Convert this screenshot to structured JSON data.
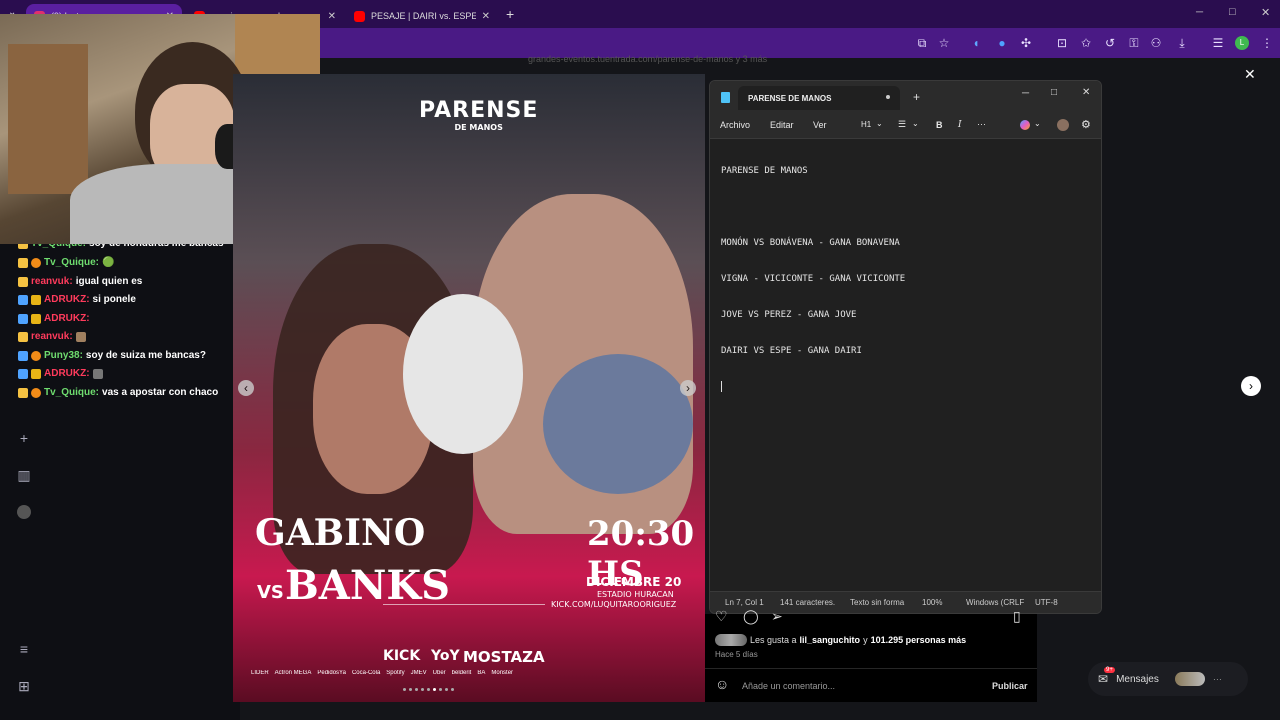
{
  "browser": {
    "tabs": [
      {
        "label": "(9) Instagram",
        "favicon_color": "#e1306c",
        "active": true
      },
      {
        "label": "pesaje parense de manos - You",
        "favicon_color": "#ff0000",
        "active": false
      },
      {
        "label": "PESAJE | DAIRI vs. ESPE | PAREN",
        "favicon_color": "#ff0000",
        "active": false
      }
    ],
    "new_tab": "+",
    "win_min": "─",
    "win_max": "□",
    "win_close": "✕"
  },
  "behind_url": "grandes-eventos.tuentrada.com/parense-de-manos y 3 más",
  "chat": [
    {
      "user": "Tv_Quique:",
      "msg": "soy de honduras me bancas",
      "color": "#6fdc6f"
    },
    {
      "user": "Tv_Quique:",
      "msg": "🟢",
      "color": "#6fdc6f"
    },
    {
      "user": "reanvuk:",
      "msg": "igual quien es",
      "color": "#ff3b5c"
    },
    {
      "user": "ADRUKZ:",
      "msg": "si ponele",
      "color": "#ff3b5c"
    },
    {
      "user": "ADRUKZ:",
      "msg": "",
      "color": "#ff3b5c"
    },
    {
      "user": "reanvuk:",
      "msg": "",
      "color": "#ff3b5c"
    },
    {
      "user": "Puny38:",
      "msg": "soy de suiza me bancas?",
      "color": "#6fdc6f"
    },
    {
      "user": "ADRUKZ:",
      "msg": "",
      "color": "#ff3b5c"
    },
    {
      "user": "Tv_Quique:",
      "msg": "vas a apostar con chaco",
      "color": "#6fdc6f"
    }
  ],
  "poster": {
    "logo_top": "PARENSE",
    "logo_bottom": "DE MANOS",
    "fighter_a": "GABINO",
    "vs": "VS",
    "fighter_b": "BANKS",
    "time": "20:30 HS",
    "date": "DICIEMBRE 20",
    "venue": "ESTADIO HURACAN",
    "site": "KICK.COM/LUQUITAROORIGUEZ",
    "sponsors_main": [
      "KICK",
      "YoY",
      "MOSTAZA"
    ],
    "sponsors_small": [
      "LIDER",
      "Actron MEGA",
      "PedidosYa",
      "Coca-Cola",
      "Spotify",
      "JMEV",
      "Uber",
      "belderit",
      "BA",
      "Monster"
    ]
  },
  "notepad": {
    "title": "PARENSE DE MANOS",
    "new_tab": "+",
    "menu": [
      "Archivo",
      "Editar",
      "Ver"
    ],
    "heading": "H1",
    "bold": "B",
    "italic": "I",
    "more": "···",
    "lines": [
      "PARENSE DE MANOS",
      "",
      "MONÓN VS BONÁVENA - GANA BONAVENA",
      "VIGNA - VICICONTE - GANA VICICONTE",
      "JOVE VS PEREZ - GANA JOVE",
      "DAIRI VS ESPE - GANA DAIRI"
    ],
    "status": {
      "position": "Ln 7, Col 1",
      "chars": "141 caracteres.",
      "format": "Texto sin forma",
      "zoom": "100%",
      "eol": "Windows (CRLF",
      "encoding": "UTF-8"
    }
  },
  "instagram": {
    "likes_prefix": "Les gusta a",
    "likes_user": "lil_sanguchito",
    "likes_mid": "y",
    "likes_count": "101.295 personas más",
    "time_ago": "Hace 5 días",
    "comment_placeholder": "Añade un comentario...",
    "publish": "Publicar",
    "messages": "Mensajes",
    "messages_badge": "9+",
    "close": "✕",
    "prev": "‹",
    "next": "›"
  }
}
